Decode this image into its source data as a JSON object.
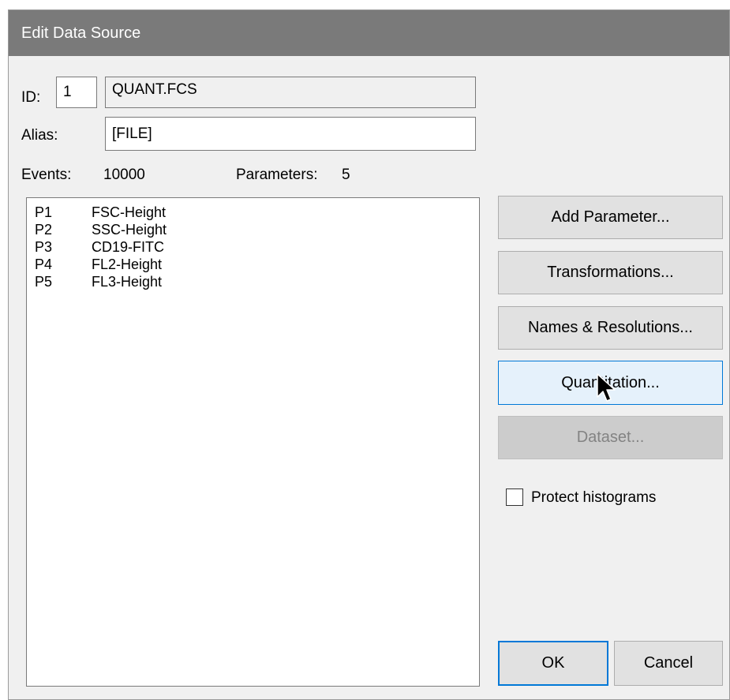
{
  "dialog": {
    "title": "Edit Data Source"
  },
  "fields": {
    "id_label": "ID:",
    "id_value": "1",
    "filename": "QUANT.FCS",
    "alias_label": "Alias:",
    "alias_value": "[FILE]"
  },
  "summary": {
    "events_label": "Events:",
    "events_value": "10000",
    "parameters_label": "Parameters:",
    "parameters_value": "5"
  },
  "parameters": [
    {
      "code": "P1",
      "name": "FSC-Height"
    },
    {
      "code": "P2",
      "name": "SSC-Height"
    },
    {
      "code": "P3",
      "name": "CD19-FITC"
    },
    {
      "code": "P4",
      "name": "FL2-Height"
    },
    {
      "code": "P5",
      "name": "FL3-Height"
    }
  ],
  "buttons": {
    "add_parameter": "Add Parameter...",
    "transformations": "Transformations...",
    "names_resolutions": "Names & Resolutions...",
    "quantitation": "Quantitation...",
    "dataset": "Dataset...",
    "ok": "OK",
    "cancel": "Cancel"
  },
  "options": {
    "protect_histograms_label": "Protect histograms",
    "protect_histograms_checked": false
  },
  "cursor_icon": "arrow-pointer-icon",
  "colors": {
    "titlebar": "#7a7a7a",
    "hover_accent": "#0078d7",
    "hover_fill": "#e5f1fb"
  }
}
